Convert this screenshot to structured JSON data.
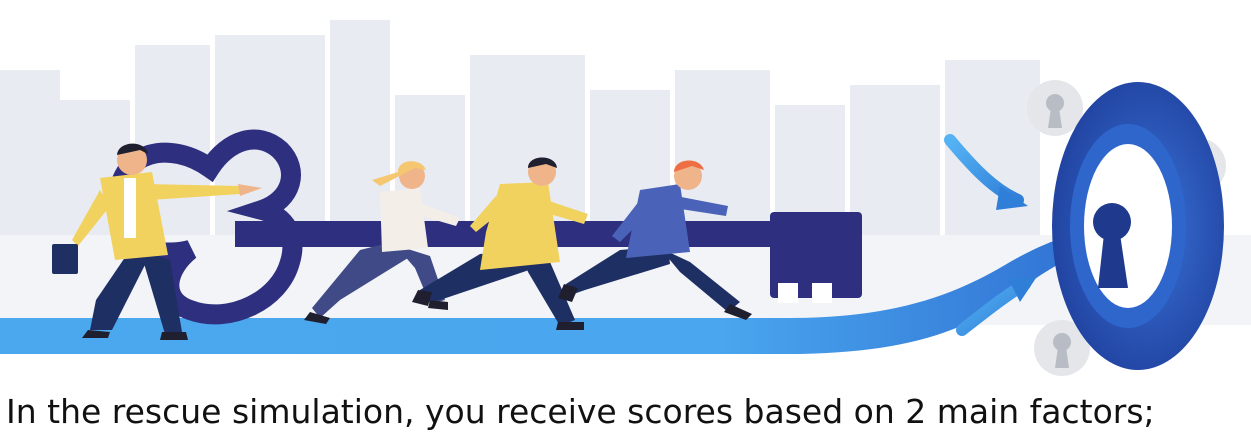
{
  "caption": {
    "text": "In the rescue simulation, you receive scores based on 2 main factors;"
  },
  "illustration": {
    "subject": "people-running-with-giant-key-icon",
    "colors": {
      "sky": "#ffffff",
      "skyline": "#e9ebf2",
      "path": "#4ba8ee",
      "path_dark": "#2f6fd2",
      "key": "#2f2f80",
      "lock_ring": "#2b5bc7",
      "lock_ring_dark": "#1f3f9c",
      "yellow_jacket": "#f2d25f",
      "navy": "#1e2f63",
      "skin": "#f0b48a",
      "hair_dark": "#1f1f2f",
      "hair_blonde": "#f4c770",
      "hair_red": "#ef6f45"
    }
  }
}
